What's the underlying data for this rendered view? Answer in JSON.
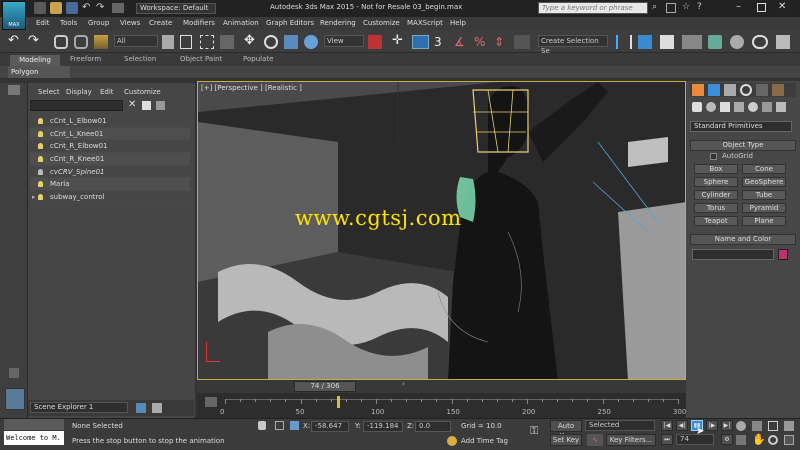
{
  "app": {
    "title": "Autodesk 3ds Max  2015  - Not for Resale    03_begin.max",
    "logo_text": "MAX",
    "workspace": "Workspace: Default",
    "search_placeholder": "Type a keyword or phrase"
  },
  "menu": [
    "Edit",
    "Tools",
    "Group",
    "Views",
    "Create",
    "Modifiers",
    "Animation",
    "Graph Editors",
    "Rendering",
    "Customize",
    "MAXScript",
    "Help"
  ],
  "toolbar": {
    "filter_value": "All",
    "view_value": "View",
    "selection_set_placeholder": "Create Selection Se"
  },
  "ribbon": {
    "tabs": [
      "Modeling",
      "Freeform",
      "Selection",
      "Object Paint",
      "Populate"
    ],
    "sub": "Polygon Modeling"
  },
  "scene": {
    "menu": [
      "Select",
      "Display",
      "Edit",
      "Customize"
    ],
    "items": [
      {
        "label": "cCnt_L_Elbow01"
      },
      {
        "label": "cCnt_L_Knee01"
      },
      {
        "label": "cCnt_R_Elbow01"
      },
      {
        "label": "cCnt_R_Knee01"
      },
      {
        "label": "cvCRV_Spine01"
      },
      {
        "label": "Maria"
      },
      {
        "label": "subway_control"
      }
    ],
    "footer": "Scene Explorer 1"
  },
  "viewport": {
    "label": "[+] [Perspective ] [Realistic ]",
    "watermark": "www.cgtsj.com"
  },
  "command_panel": {
    "category": "Standard Primitives",
    "object_type_title": "Object Type",
    "autogrid_label": "AutoGrid",
    "buttons": [
      "Box",
      "Cone",
      "Sphere",
      "GeoSphere",
      "Cylinder",
      "Tube",
      "Torus",
      "Pyramid",
      "Teapot",
      "Plane"
    ],
    "name_color_title": "Name and Color",
    "object_color": "#c0306e"
  },
  "timeline": {
    "frame_display": "74 / 306",
    "current_frame": 74,
    "total_frames": 306,
    "ticks": [
      "0",
      "50",
      "100",
      "150",
      "200",
      "250",
      "300"
    ]
  },
  "status": {
    "welcome": "Welcome to M.",
    "selection": "None Selected",
    "prompt": "Press the stop button to stop the animation",
    "x_label": "X:",
    "x_value": "-58.647",
    "y_label": "Y:",
    "y_value": "-119.184",
    "z_label": "Z:",
    "z_value": "0.0",
    "grid": "Grid = 10.0",
    "add_time_tag": "Add Time Tag",
    "auto_key": "Auto Key",
    "set_key": "Set Key",
    "selected": "Selected",
    "key_filters": "Key Filters...",
    "frame_field": "74"
  },
  "colors": {
    "accent_yellow": "#ffe400",
    "viewport_border": "#d0a640",
    "active_blue": "#3b8fd8"
  }
}
